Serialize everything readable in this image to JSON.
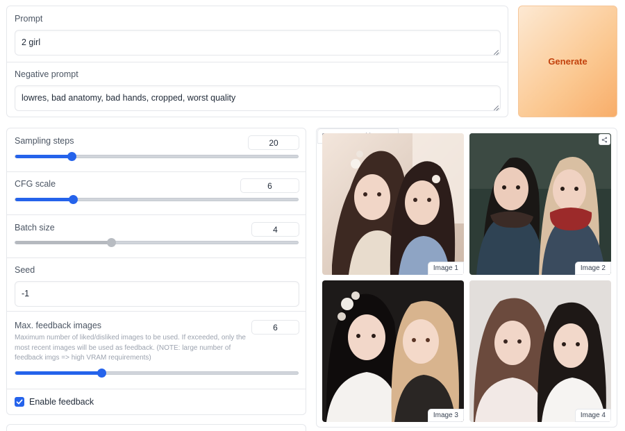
{
  "prompt": {
    "label": "Prompt",
    "value": "2 girl"
  },
  "negative_prompt": {
    "label": "Negative prompt",
    "value": "lowres, bad anatomy, bad hands, cropped, worst quality"
  },
  "generate": {
    "label": "Generate"
  },
  "sampling_steps": {
    "label": "Sampling steps",
    "value": "20",
    "fraction": 0.2
  },
  "cfg_scale": {
    "label": "CFG scale",
    "value": "6",
    "fraction": 0.2
  },
  "batch_size": {
    "label": "Batch size",
    "value": "4",
    "fraction": 0.34
  },
  "seed": {
    "label": "Seed",
    "value": "-1"
  },
  "max_feedback": {
    "label": "Max. feedback images",
    "value": "6",
    "fraction": 0.3,
    "description": "Maximum number of liked/disliked images to be used. If exceeded, only the most recent images will be used as feedback. (NOTE: large number of feedback imgs => high VRAM requirements)"
  },
  "enable_feedback": {
    "label": "Enable feedback",
    "checked": true
  },
  "gallery": {
    "label": "Generated images",
    "images": [
      {
        "caption": "Image 1"
      },
      {
        "caption": "Image 2"
      },
      {
        "caption": "Image 3"
      },
      {
        "caption": "Image 4"
      }
    ]
  },
  "colors": {
    "accent": "#2563eb",
    "generate_text": "#c2410c"
  }
}
